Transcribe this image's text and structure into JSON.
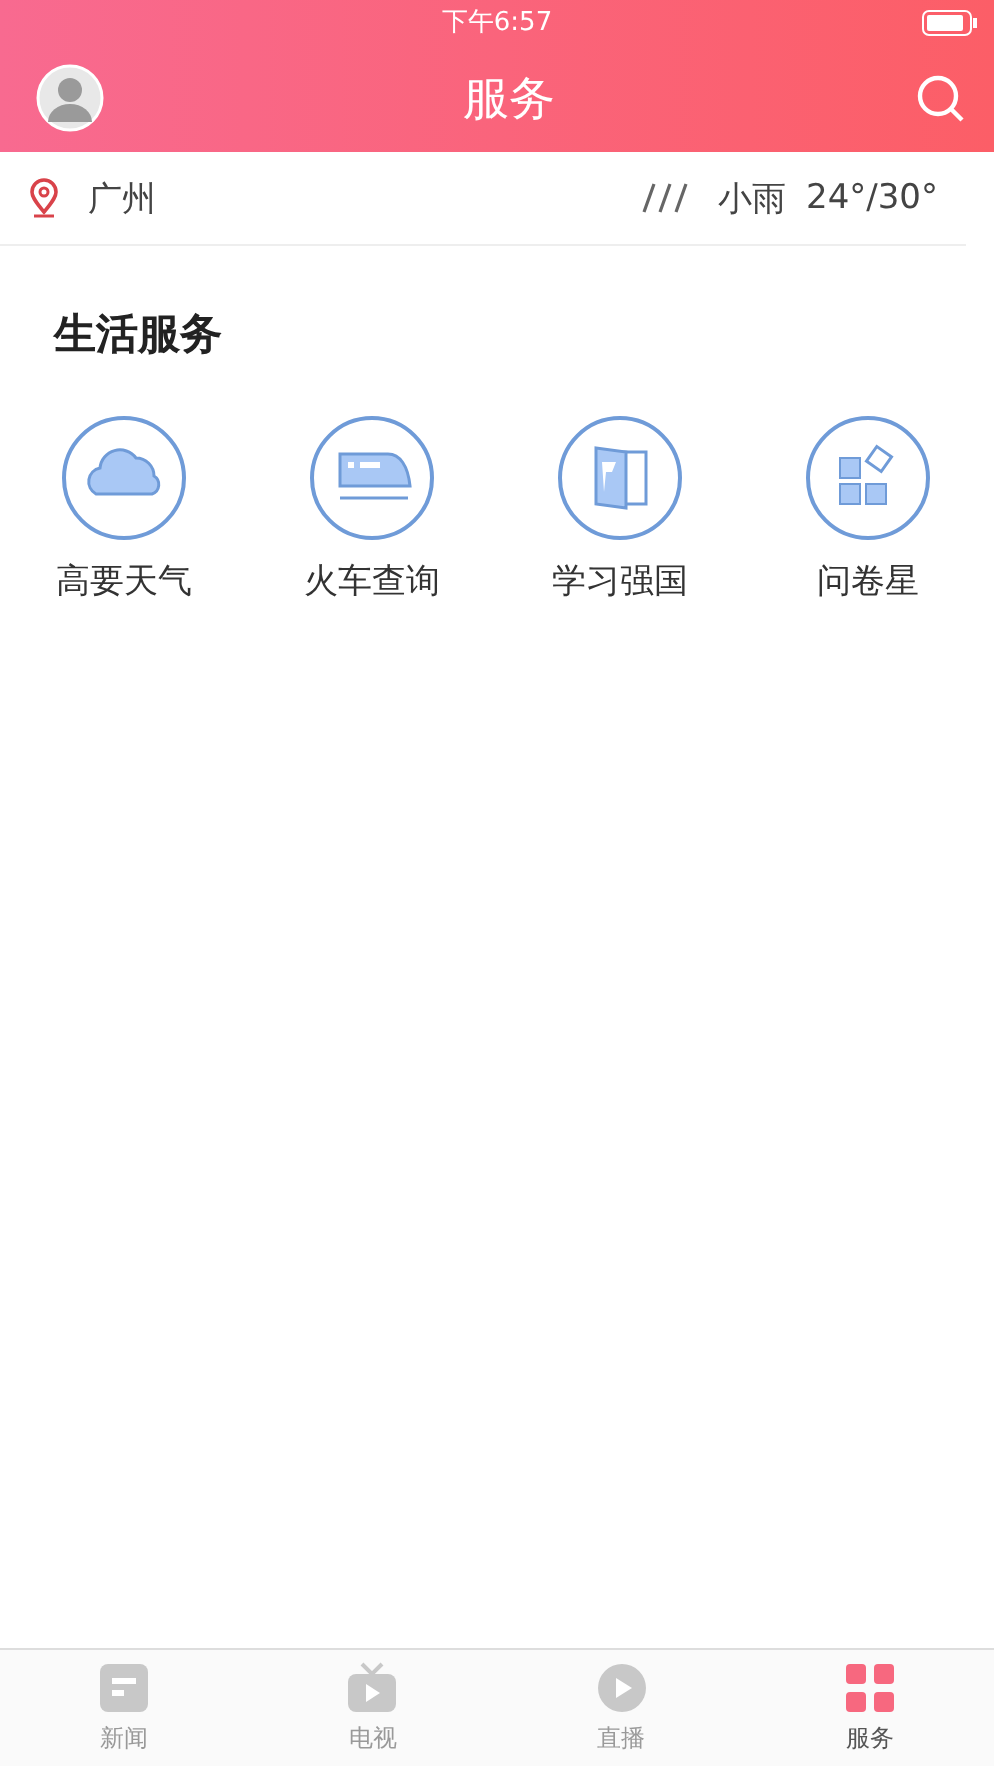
{
  "status_bar": {
    "time": "下午6:57"
  },
  "header": {
    "title": "服务"
  },
  "location_bar": {
    "city": "广州",
    "weather": "小雨",
    "temperature": "24°/30°"
  },
  "section": {
    "title": "生活服务",
    "items": [
      {
        "kind": "cloud",
        "label": "高要天气"
      },
      {
        "kind": "train",
        "label": "火车查询"
      },
      {
        "kind": "flag",
        "label": "学习强国"
      },
      {
        "kind": "blocks",
        "label": "问卷星"
      }
    ]
  },
  "tab_bar": [
    {
      "kind": "news",
      "label": "新闻",
      "selected": false
    },
    {
      "kind": "tv",
      "label": "电视",
      "selected": false
    },
    {
      "kind": "play",
      "label": "直播",
      "selected": false
    },
    {
      "kind": "service",
      "label": "服务",
      "selected": true
    }
  ]
}
